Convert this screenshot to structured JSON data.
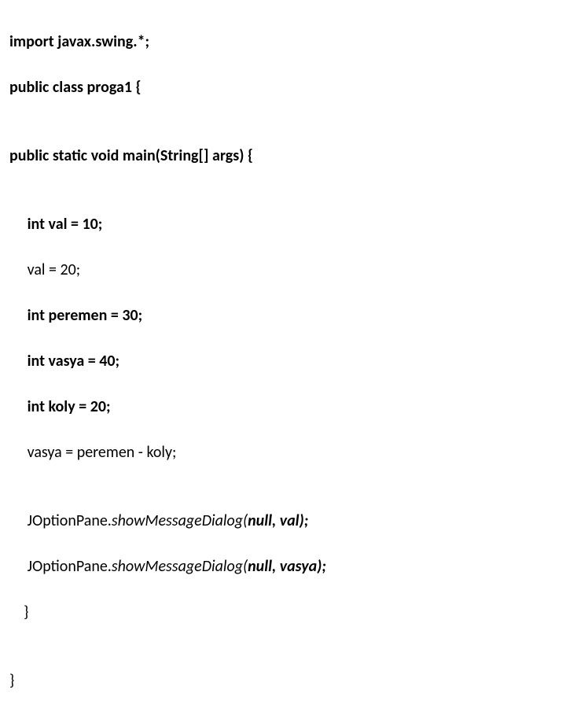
{
  "code": {
    "l1": "import javax.swing.*;",
    "l2": "public class proga1 {",
    "l3": "",
    "l4": "public static void main(String[] args) {",
    "l5": "",
    "l6_a": "     int val = 10;",
    "l7_a": "     ",
    "l7_b": "val = 20;",
    "l8_a": "     int peremen = 30;",
    "l9_a": "     int vasya = 40;",
    "l10_a": "     int koly = 20;",
    "l11_a": "     ",
    "l11_b": "vasya = peremen - koly;",
    "l12": "",
    "l13_a": "     ",
    "l13_b": "JOptionPane.",
    "l13_c": "showMessageDialog(",
    "l13_d": "null, ",
    "l13_e": "val);",
    "l14_a": "     ",
    "l14_b": "JOptionPane.",
    "l14_c": "showMessageDialog(",
    "l14_d": "null, ",
    "l14_e": "vasya);",
    "l15_a": "    ",
    "l15_b": "}",
    "l16": "",
    "l17": "}"
  }
}
